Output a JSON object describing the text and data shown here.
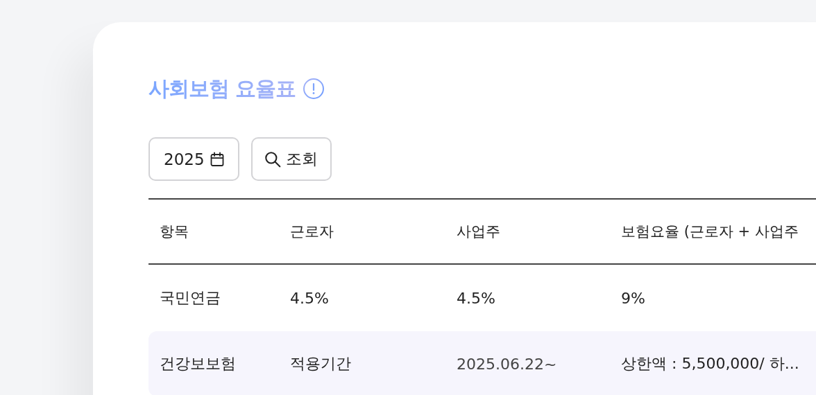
{
  "title": "사회보험 요율표",
  "toolbar": {
    "year": "2025",
    "search_button": "조회"
  },
  "table": {
    "columns": [
      "항목",
      "근로자",
      "사업주",
      "보험요율 (근로자 + 사업주"
    ],
    "rows": [
      {
        "highlighted": false,
        "cells": [
          "국민연금",
          "4.5%",
          "4.5%",
          "9%"
        ]
      },
      {
        "highlighted": true,
        "cells": [
          "건강보보험",
          "적용기간",
          "2025.06.22~",
          "상한액 : 5,500,000/ 하..."
        ]
      }
    ]
  }
}
